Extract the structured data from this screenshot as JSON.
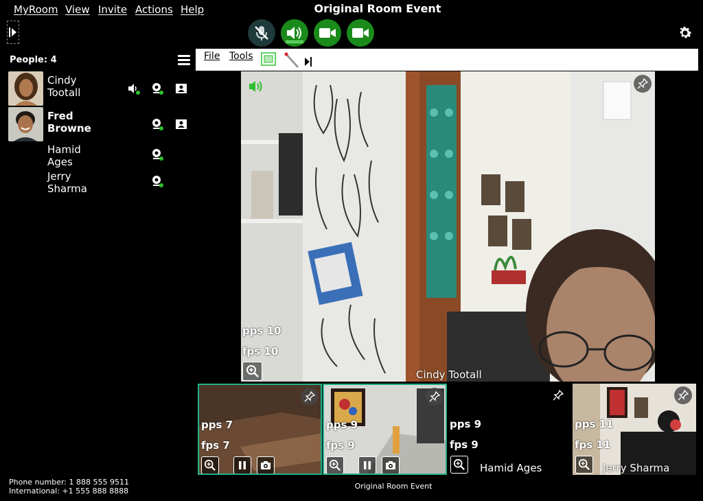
{
  "menu": {
    "myroom": "MyRoom",
    "view": "View",
    "invite": "Invite",
    "actions": "Actions",
    "help": "Help"
  },
  "room_title": "Original Room Event",
  "people": {
    "header": "People: 4",
    "list": [
      {
        "first": "Cindy",
        "last": "Tootall"
      },
      {
        "first": "Fred",
        "last": "Browne"
      },
      {
        "first": "Hamid",
        "last": "Ages"
      },
      {
        "first": "Jerry",
        "last": "Sharma"
      }
    ]
  },
  "phone": {
    "local": "Phone number: 1 888 555 9511",
    "intl": "International:  +1 555 888 8888"
  },
  "toolbar": {
    "file": "File",
    "tools": "Tools"
  },
  "main_video": {
    "pps": "pps 10",
    "fps": "fps 10",
    "name": "Cindy Tootall"
  },
  "thumbs": [
    {
      "pps": "pps 7",
      "fps": "fps 7",
      "name": ""
    },
    {
      "pps": "pps 9",
      "fps": "fps 9",
      "name": ""
    },
    {
      "pps": "pps 9",
      "fps": "fps 9",
      "name": "Hamid Ages"
    },
    {
      "pps": "pps 11",
      "fps": "fps 11",
      "name": "Jerry Sharma"
    }
  ],
  "footer_title": "Original Room Event",
  "colors": {
    "accent": "#20b08a",
    "active_control": "#1a8a1a",
    "status_online": "#2ec02e"
  }
}
